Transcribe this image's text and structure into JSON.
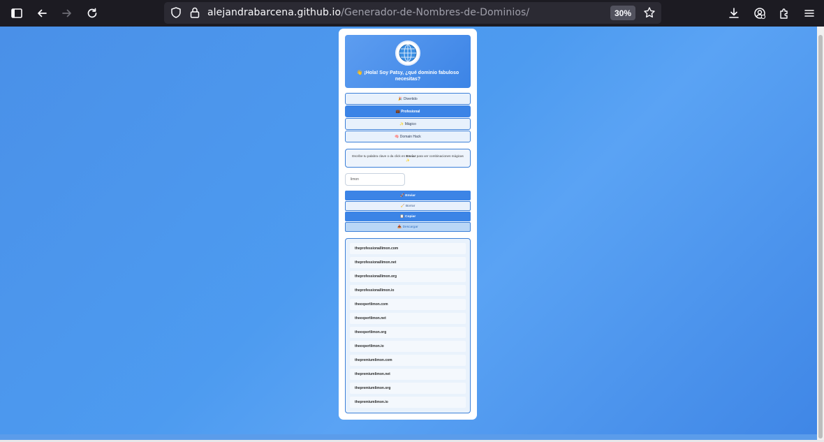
{
  "browser": {
    "url_host": "alejandrabarcena.github.io",
    "url_path": "/Generador-de-Nombres-de-Dominios/",
    "zoom": "30%"
  },
  "app": {
    "greeting": "👋 ¡Hola! Soy Patsy, ¿qué dominio fabuloso necesitas?",
    "categories": [
      {
        "label": "🎉 Divertido",
        "active": false
      },
      {
        "label": "💼 Profesional",
        "active": true
      },
      {
        "label": "✨ Mágico",
        "active": false
      },
      {
        "label": "🧠 Domain Hack",
        "active": false
      }
    ],
    "hint": {
      "before": "Escribe tu palabra clave o da click en ",
      "bold": "Enviar",
      "after": " para ver combinaciones mágicas ✨"
    },
    "input_value": "limon",
    "actions": {
      "send": "🚀 Enviar",
      "clear": "🧹 Borrar",
      "copy": "📋 Copiar",
      "download": "📥 Descargar"
    },
    "results": [
      "theprofessionallimon.com",
      "theprofessionallimon.net",
      "theprofessionallimon.org",
      "theprofessionallimon.io",
      "theexpertlimon.com",
      "theexpertlimon.net",
      "theexpertlimon.org",
      "theexpertlimon.io",
      "thepremiumlimon.com",
      "thepremiumlimon.net",
      "thepremiumlimon.org",
      "thepremiumlimon.io"
    ]
  },
  "colors": {
    "accent": "#3c84e6",
    "chrome_bg": "#1c1b22"
  }
}
